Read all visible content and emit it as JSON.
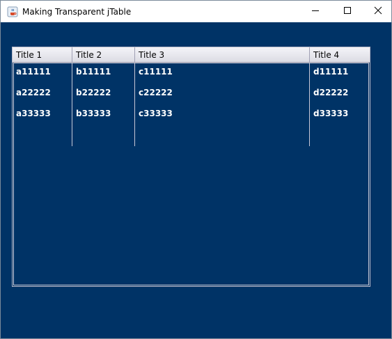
{
  "window": {
    "title": "Making Transparent jTable",
    "icon": "java-cup-icon",
    "controls": {
      "minimize_icon": "minimize-icon",
      "maximize_icon": "maximize-icon",
      "close_icon": "close-icon"
    }
  },
  "colors": {
    "background": "#003366",
    "cell_text": "#ffffff",
    "grid_lines": "#c8c8d6"
  },
  "table": {
    "columns": [
      "Title 1",
      "Title 2",
      "Title 3",
      "Title 4"
    ],
    "rows": [
      [
        "a11111",
        "b11111",
        "c11111",
        "d11111"
      ],
      [
        "a22222",
        "b22222",
        "c22222",
        "d22222"
      ],
      [
        "a33333",
        "b33333",
        "c33333",
        "d33333"
      ]
    ]
  }
}
